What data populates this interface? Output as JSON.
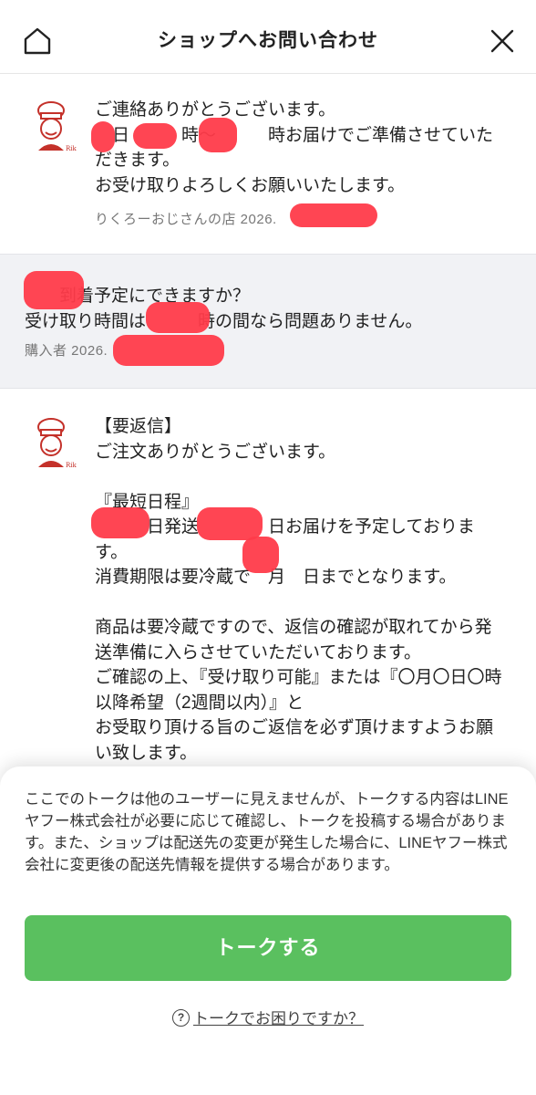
{
  "header": {
    "title": "ショップへお問い合わせ",
    "home_icon": "home-icon",
    "close_icon": "close-icon"
  },
  "messages": [
    {
      "sender": "shop",
      "text": "ご連絡ありがとうございます。\n　日　　　時〜　　　時お届けでご準備させていただきます。\nお受け取りよろしくお願いいたします。",
      "meta": "りくろーおじさんの店 2026."
    },
    {
      "sender": "buyer",
      "text": "　　到着予定にできますか？\n受け取り時間は　　　時の間なら問題ありません。",
      "meta": "購入者 2026."
    },
    {
      "sender": "shop",
      "text": "【要返信】\nご注文ありがとうございます。\n\n『最短日程』\n　　　日発送　　　　日お届けを予定しております。\n消費期限は要冷蔵で　月　日までとなります。\n\n商品は要冷蔵ですので、返信の確認が取れてから発送準備に入らさせていただいております。\nご確認の上、『受け取り可能』または『〇月〇日〇時以降希望（2週間以内）』と\nお受取り頂ける旨のご返信を必ず頂けますようお願い致します。\n\n何か不都合がございまして変更や時間指定がござい"
    }
  ],
  "sheet": {
    "notice": "ここでのトークは他のユーザーに見えませんが、トークする内容はLINEヤフー株式会社が必要に応じて確認し、トークを投稿する場合があります。また、ショップは配送先の変更が発生した場合に、LINEヤフー株式会社に変更後の配送先情報を提供する場合があります。",
    "talk_button": "トークする",
    "help_link": "トークでお困りですか？",
    "help_icon": "question-circle-icon",
    "accent_color": "#5ac05f"
  },
  "colors": {
    "redaction": "#ff3b4a",
    "buyer_bg": "#f1f2f5"
  }
}
